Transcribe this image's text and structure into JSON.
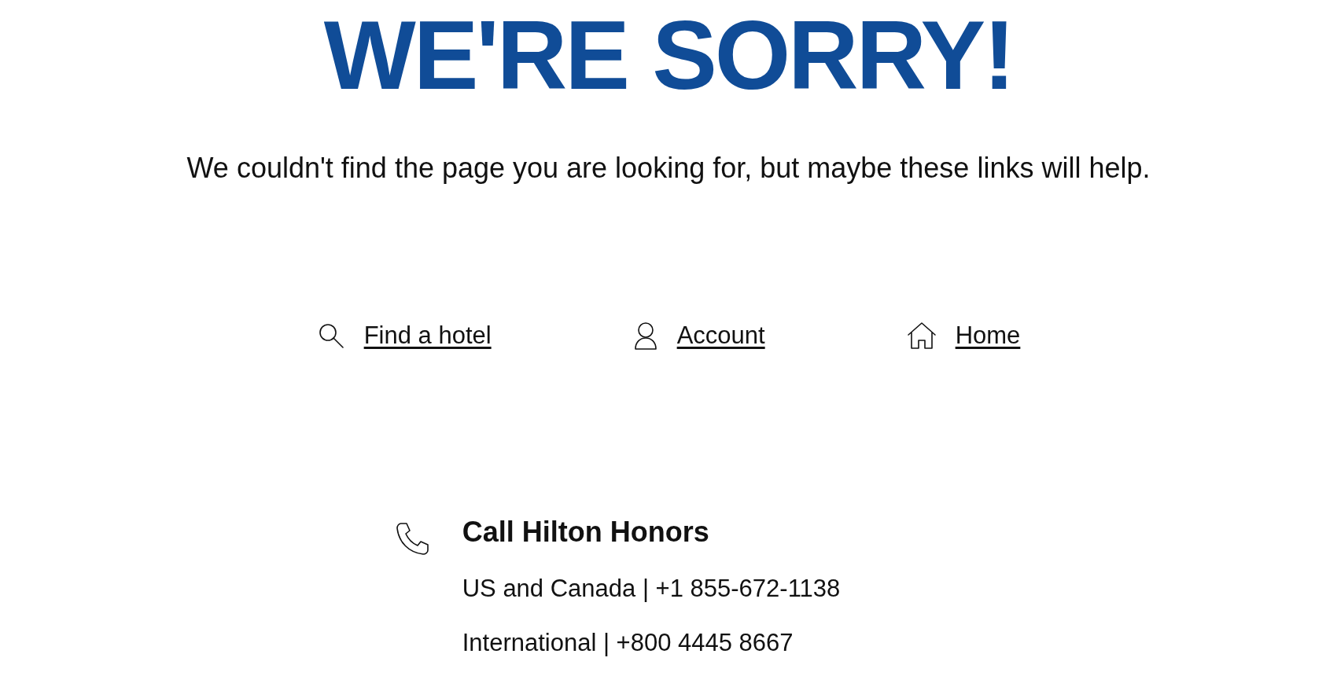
{
  "heading": "WE'RE SORRY!",
  "message": "We couldn't find the page you are looking for, but maybe these links will help.",
  "links": [
    {
      "kind": "search",
      "label": "Find a hotel"
    },
    {
      "kind": "account",
      "label": "Account"
    },
    {
      "kind": "home",
      "label": "Home"
    }
  ],
  "contact": {
    "title": "Call Hilton Honors",
    "lines": [
      "US and Canada | +1 855-672-1138",
      "International | +800 4445 8667"
    ]
  }
}
